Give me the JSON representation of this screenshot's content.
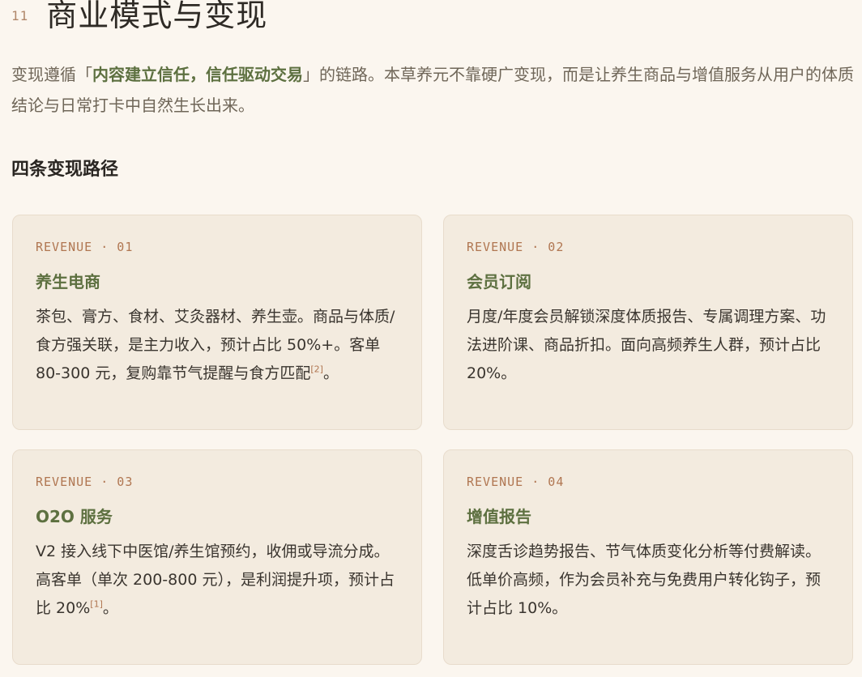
{
  "section": {
    "number": "11",
    "title": "商业模式与变现"
  },
  "intro": {
    "pre": "变现遵循「",
    "highlight": "内容建立信任，信任驱动交易",
    "post": "」的链路。本草养元不靠硬广变现，而是让养生商品与增值服务从用户的体质结论与日常打卡中自然生长出来。"
  },
  "paths_heading": "四条变现路径",
  "cards": [
    {
      "tag": "REVENUE · 01",
      "title": "养生电商",
      "body": "茶包、膏方、食材、艾灸器材、养生壶。商品与体质/食方强关联，是主力收入，预计占比 50%+。客单 80-300 元，复购靠节气提醒与食方匹配",
      "cite": "[2]",
      "tail": "。"
    },
    {
      "tag": "REVENUE · 02",
      "title": "会员订阅",
      "body": "月度/年度会员解锁深度体质报告、专属调理方案、功法进阶课、商品折扣。面向高频养生人群，预计占比 20%。",
      "cite": "",
      "tail": ""
    },
    {
      "tag": "REVENUE · 03",
      "title": "O2O 服务",
      "body": "V2 接入线下中医馆/养生馆预约，收佣或导流分成。高客单（单次 200-800 元），是利润提升项，预计占比 20%",
      "cite": "[1]",
      "tail": "。"
    },
    {
      "tag": "REVENUE · 04",
      "title": "增值报告",
      "body": "深度舌诊趋势报告、节气体质变化分析等付费解读。低单价高频，作为会员补充与免费用户转化钩子，预计占比 10%。",
      "cite": "",
      "tail": ""
    }
  ]
}
